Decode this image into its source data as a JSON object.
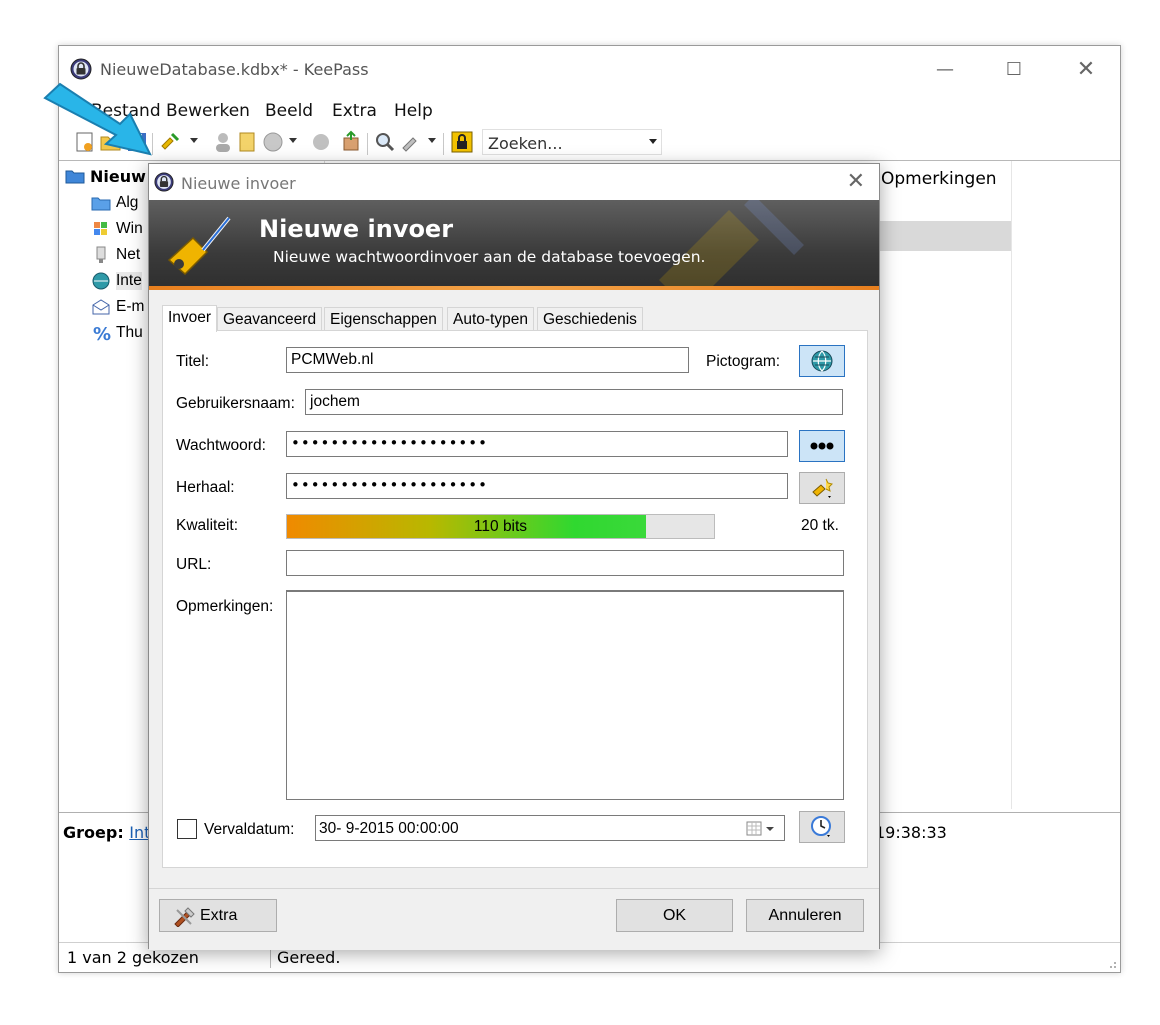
{
  "main": {
    "title": "NieuweDatabase.kdbx* - KeePass",
    "menu": [
      "Bestand",
      "Bewerken",
      "Beeld",
      "Extra",
      "Help"
    ],
    "search_placeholder": "Zoeken...",
    "tree": {
      "root": "Nieuw",
      "items": [
        "Alg",
        "Win",
        "Net",
        "Inte",
        "E-m",
        "Thu"
      ]
    },
    "list_column": "Opmerkingen",
    "info": {
      "group_label": "Groep:",
      "group_link": "Inte",
      "time": "19:38:33"
    },
    "status": {
      "selection": "1 van 2 gekozen",
      "state": "Gereed."
    }
  },
  "dialog": {
    "title": "Nieuwe invoer",
    "banner_title": "Nieuwe invoer",
    "banner_subtitle": "Nieuwe wachtwoordinvoer aan de database toevoegen.",
    "tabs": [
      "Invoer",
      "Geavanceerd",
      "Eigenschappen",
      "Auto-typen",
      "Geschiedenis"
    ],
    "fields": {
      "title_label": "Titel:",
      "title_value": "PCMWeb.nl",
      "icon_label": "Pictogram:",
      "username_label": "Gebruikersnaam:",
      "username_value": "jochem",
      "password_label": "Wachtwoord:",
      "password_value": "••••••••••••••••••••",
      "repeat_label": "Herhaal:",
      "repeat_value": "••••••••••••••••••••",
      "quality_label": "Kwaliteit:",
      "quality_text": "110 bits",
      "quality_fraction": 0.84,
      "char_count": "20 tk.",
      "url_label": "URL:",
      "url_value": "",
      "notes_label": "Opmerkingen:",
      "expiry_label": "Vervaldatum:",
      "expiry_value": "30-  9-2015 00:00:00",
      "expiry_checked": false
    },
    "buttons": {
      "extra": "Extra",
      "ok": "OK",
      "cancel": "Annuleren"
    }
  },
  "colors": {
    "accent_orange": "#e87f1e",
    "selection_blue": "#cce4f7",
    "link": "#1a5fb4"
  },
  "icons": [
    "keepass-lock-icon",
    "key-wand-icon",
    "globe-icon",
    "dots-icon",
    "password-generator-icon",
    "calendar-icon",
    "clock-icon",
    "tools-icon",
    "pointer-arrow"
  ]
}
